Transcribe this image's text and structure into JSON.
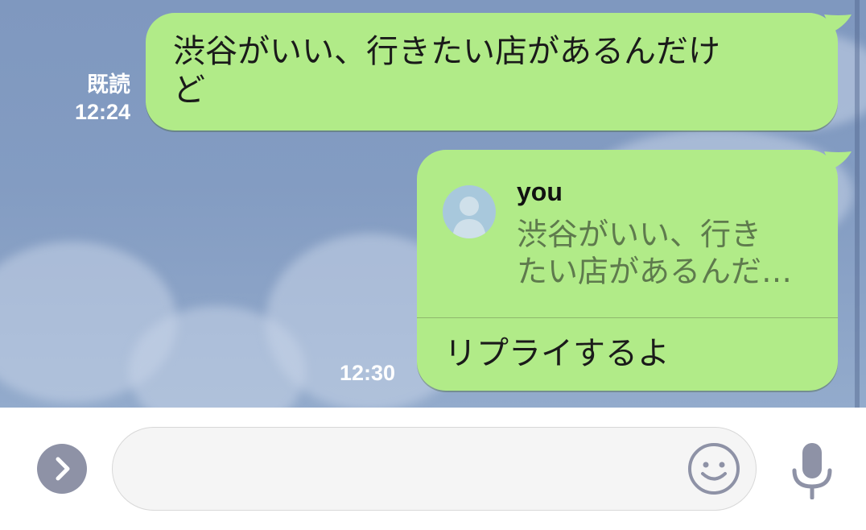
{
  "messages": [
    {
      "text_line1": "渋谷がいい、行きたい店があるんだけ",
      "text_line2": "ど",
      "read_label": "既読",
      "time": "12:24"
    },
    {
      "reply_to": {
        "name": "you",
        "preview_line1": "渋谷がいい、行き",
        "preview_line2": "たい店があるんだ…"
      },
      "text": "リプライするよ",
      "time": "12:30"
    }
  ],
  "input": {
    "value": "",
    "placeholder": ""
  },
  "icons": {
    "expand": "chevron-right-icon",
    "emoji": "smiley-icon",
    "mic": "microphone-icon"
  },
  "colors": {
    "bubble": "#b1eb88",
    "chat_background": "#839cc2",
    "quote_text": "#5e7a4d"
  }
}
